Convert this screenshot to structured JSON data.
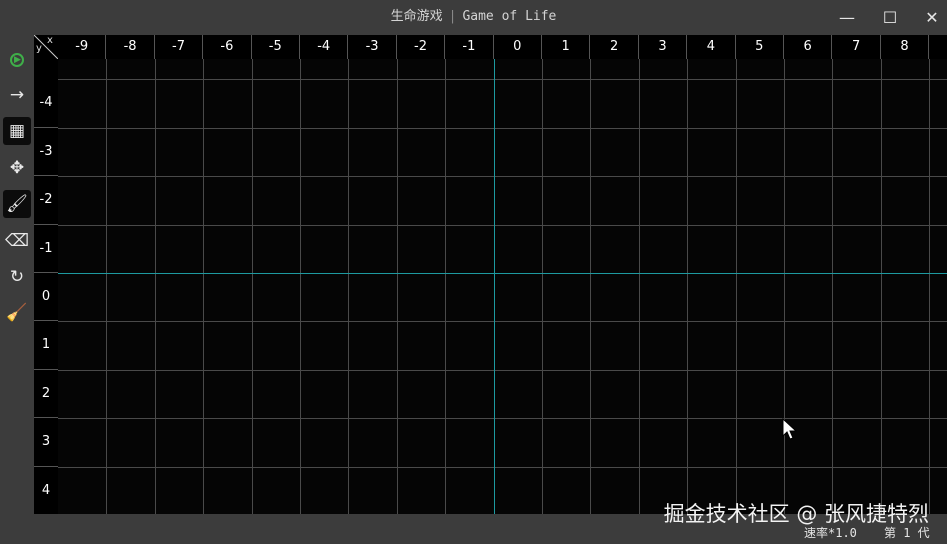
{
  "window": {
    "title_cn": "生命游戏",
    "title_en": "Game of Life",
    "separator": "|",
    "minimize_glyph": "—",
    "maximize_glyph": "☐",
    "close_glyph": "✕"
  },
  "toolbar": {
    "tools": [
      {
        "name": "play-icon",
        "glyph": "▶",
        "active": false,
        "color": "#3fae49"
      },
      {
        "name": "step-arrow-icon",
        "glyph": "→",
        "active": false
      },
      {
        "name": "grid-icon",
        "glyph": "▦",
        "active": true
      },
      {
        "name": "move-icon",
        "glyph": "✥",
        "active": false
      },
      {
        "name": "brush-icon",
        "glyph": "🖌",
        "active": true
      },
      {
        "name": "eraser-icon",
        "glyph": "⌫",
        "active": false
      },
      {
        "name": "reset-icon",
        "glyph": "↻",
        "active": false
      },
      {
        "name": "clear-broom-icon",
        "glyph": "🧹",
        "active": false
      }
    ]
  },
  "grid": {
    "corner_x": "x",
    "corner_y": "y",
    "x_ticks": [
      "-9",
      "-8",
      "-7",
      "-6",
      "-5",
      "-4",
      "-3",
      "-2",
      "-1",
      "0",
      "1",
      "2",
      "3",
      "4",
      "5",
      "6",
      "7",
      "8"
    ],
    "y_ticks": [
      "-4",
      "-3",
      "-2",
      "-1",
      "0",
      "1",
      "2",
      "3",
      "4"
    ],
    "axis_color": "#1d9aa0",
    "grid_color": "#4a4a4a"
  },
  "status": {
    "watermark": "掘金技术社区 @ 张风捷特烈",
    "speed": "速率*1.0",
    "generation": "第 1 代"
  }
}
